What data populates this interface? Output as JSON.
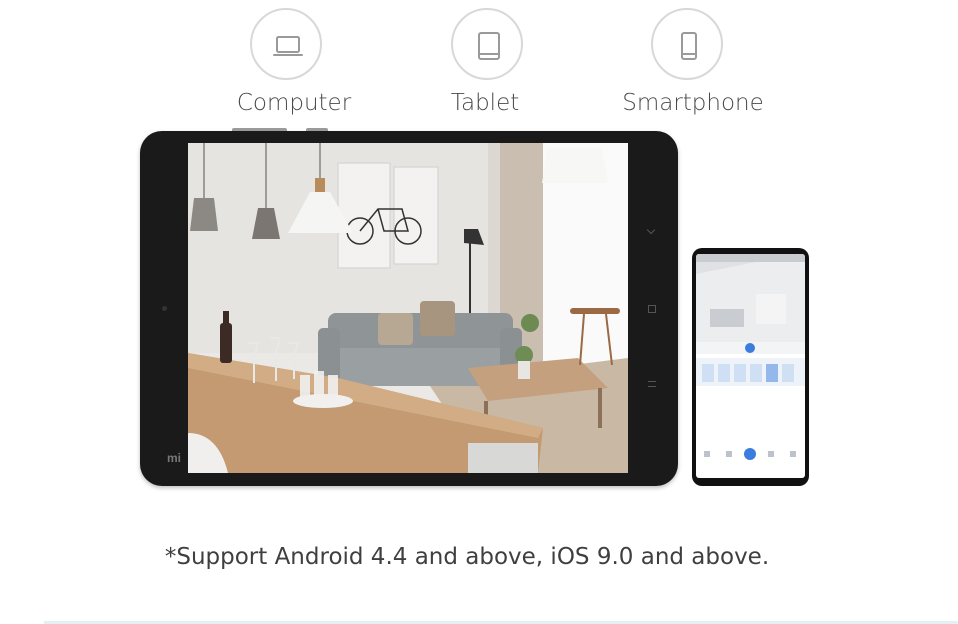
{
  "devices": [
    {
      "label": "Computer",
      "icon": "laptop-icon"
    },
    {
      "label": "Tablet",
      "icon": "tablet-icon"
    },
    {
      "label": "Smartphone",
      "icon": "smartphone-icon"
    }
  ],
  "tablet_brand": "mi",
  "support_note": "*Support Android 4.4 and above, iOS 9.0 and above.",
  "colors": {
    "icon_stroke": "#9a9a9a",
    "device_body": "#1a1a1a",
    "text": "#444444",
    "phone_accent": "#3b7ddd"
  }
}
